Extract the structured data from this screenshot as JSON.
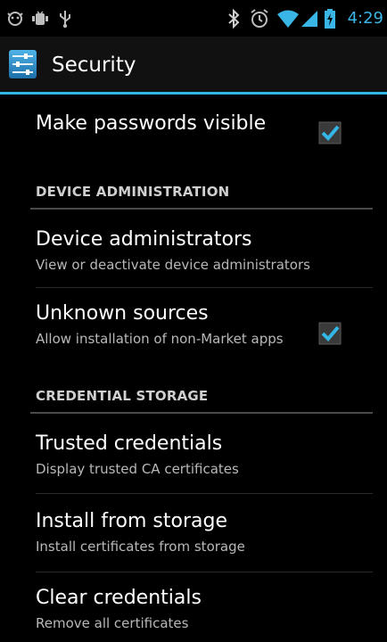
{
  "status_bar": {
    "time": "4:29",
    "accent_color": "#39b5e6",
    "left_icons": [
      "android-debug-icon",
      "device-icon",
      "usb-icon"
    ],
    "right_icons": [
      "bluetooth-icon",
      "alarm-icon",
      "wifi-icon",
      "signal-icon",
      "battery-charging-icon"
    ]
  },
  "action_bar": {
    "title": "Security",
    "icon": "settings-icon"
  },
  "sections": {
    "top": {
      "make_passwords_visible": {
        "title": "Make passwords visible",
        "checked": true
      }
    },
    "device_administration": {
      "header": "DEVICE ADMINISTRATION",
      "device_administrators": {
        "title": "Device administrators",
        "summary": "View or deactivate device administrators"
      },
      "unknown_sources": {
        "title": "Unknown sources",
        "summary": "Allow installation of non-Market apps",
        "checked": true
      }
    },
    "credential_storage": {
      "header": "CREDENTIAL STORAGE",
      "trusted_credentials": {
        "title": "Trusted credentials",
        "summary": "Display trusted CA certificates"
      },
      "install_from_storage": {
        "title": "Install from storage",
        "summary": "Install certificates from storage"
      },
      "clear_credentials": {
        "title": "Clear credentials",
        "summary": "Remove all certificates"
      }
    }
  }
}
